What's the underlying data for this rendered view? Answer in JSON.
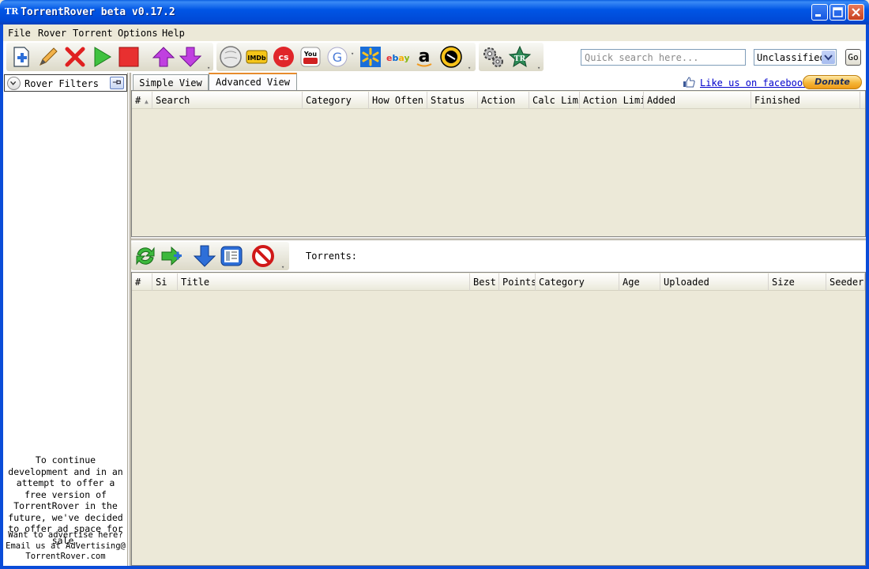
{
  "window": {
    "title": "TorrentRover beta v0.17.2",
    "app_icon_text": "TR"
  },
  "menu": [
    "File",
    "Rover",
    "Torrent",
    "Options",
    "Help"
  ],
  "toolbar": {
    "search_placeholder": "Quick search here...",
    "category_select": "Unclassified",
    "go_label": "Go"
  },
  "left_panel": {
    "filters_label": "Rover Filters",
    "ad_text": "To continue development and in an attempt to offer a free version of TorrentRover in the future, we've decided to offer ad space for sale.",
    "ad_contact": "Want to advertise here? Email us at Advertising@ TorrentRover.com"
  },
  "tabs": [
    {
      "label": "Simple View",
      "active": false
    },
    {
      "label": "Advanced View",
      "active": true
    }
  ],
  "links": {
    "facebook": "Like us on facebook",
    "donate": "Donate"
  },
  "upper_grid": {
    "columns": [
      "#",
      "Search",
      "Category",
      "How Often",
      "Status",
      "Action",
      "Calc Limit",
      "Action Limit",
      "Added",
      "Finished"
    ]
  },
  "lower_toolbar": {
    "torrents_label": "Torrents:"
  },
  "lower_grid": {
    "columns": [
      "#",
      "Si",
      "Title",
      "Best",
      "Points",
      "Category",
      "Age",
      "Uploaded",
      "Size",
      "Seeders"
    ]
  },
  "colors": {
    "titlebar": "#0055e5",
    "panel": "#ece9d8",
    "link": "#0000cc",
    "donate": "#f5b638"
  }
}
